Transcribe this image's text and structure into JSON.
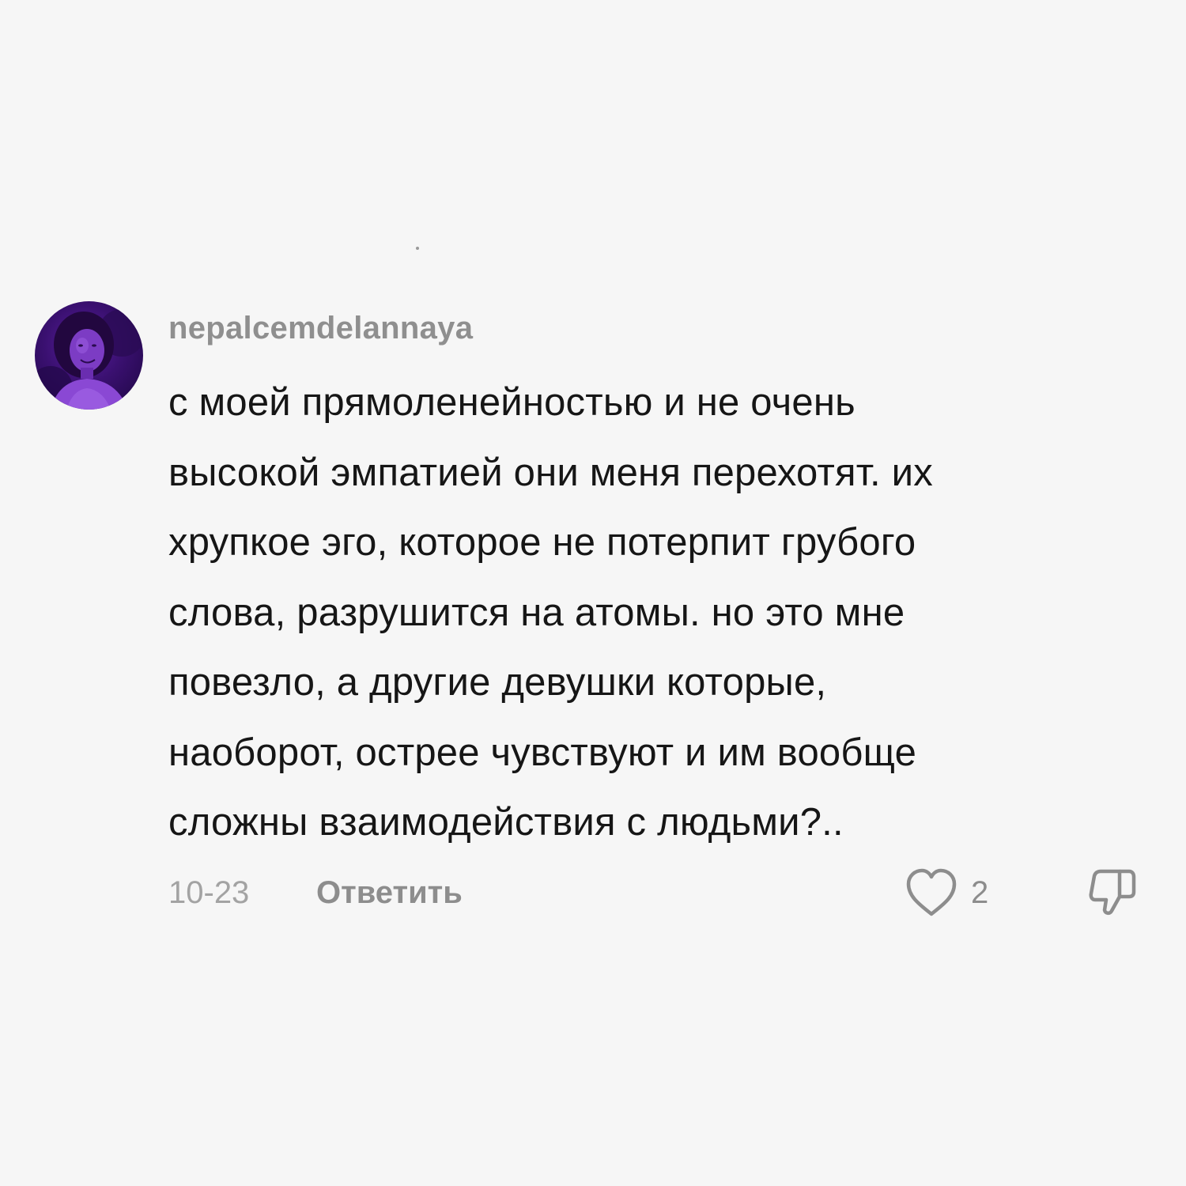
{
  "comment": {
    "username": "nepalcemdelannaya",
    "text": "с моей прямоленейностью и не очень\nвысокой эмпатией они меня перехотят. их\nхрупкое эго, которое не потерпит грубого\nслова, разрушится на атомы. но это мне\nповезло, а другие девушки которые,\nнаоборот, острее чувствуют и им вообще\nсложны взаимодействия с людьми?..",
    "date": "10-23",
    "reply_label": "Ответить",
    "like_count": "2",
    "avatar_icon": "user-avatar-photo",
    "like_icon": "heart-outline-icon",
    "dislike_icon": "thumbs-down-outline-icon"
  },
  "colors": {
    "background": "#f6f6f6",
    "username": "#8f8f8f",
    "text": "#161616",
    "meta": "#a3a3a3",
    "avatar_tint": "#5a1fa0"
  }
}
